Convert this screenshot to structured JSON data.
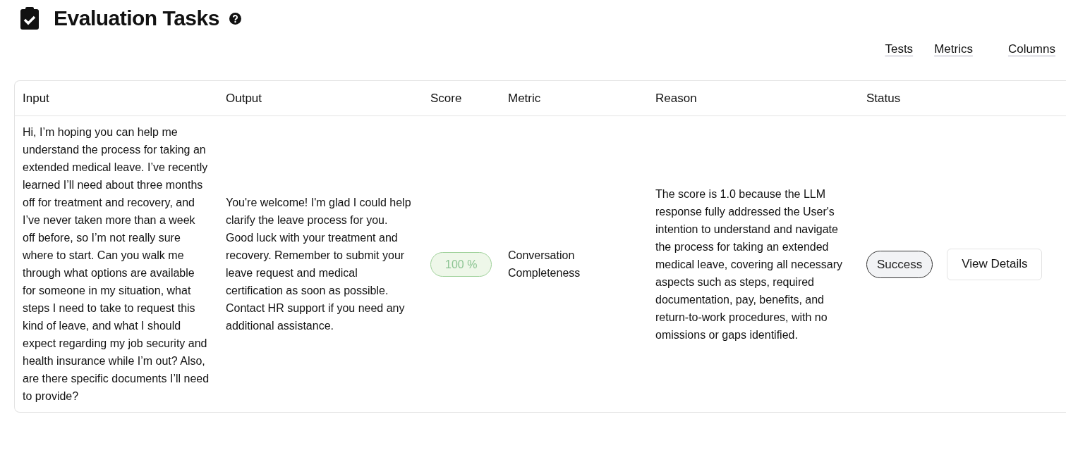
{
  "header": {
    "title": "Evaluation Tasks"
  },
  "toolbar_links": [
    "Tests",
    "Metrics",
    "Columns"
  ],
  "table": {
    "columns": [
      "Input",
      "Output",
      "Score",
      "Metric",
      "Reason",
      "Status"
    ],
    "rows": [
      {
        "input": "Hi, I’m hoping you can help me understand the process for taking an extended medical leave. I’ve recently learned I’ll need about three months off for treatment and recovery, and I’ve never taken more than a week off before, so I’m not really sure where to start. Can you walk me through what options are available for someone in my situation, what steps I need to take to request this kind of leave, and what I should expect regarding my job security and health insurance while I’m out? Also, are there specific documents I’ll need to provide?",
        "output": "You're welcome! I'm glad I could help clarify the leave process for you. Good luck with your treatment and recovery. Remember to submit your leave request and medical certification as soon as possible. Contact HR support if you need any additional assistance.",
        "score": {
          "label": "100 %",
          "kind": "pass"
        },
        "metric": "Conversation Completeness",
        "reason": "The score is 1.0 because the LLM response fully addressed the User's intention to understand and navigate the process for taking an extended medical leave, covering all necessary aspects such as steps, required documentation, pay, benefits, and return-to-work procedures, with no omissions or gaps identified.",
        "status": {
          "label": "Success",
          "kind": "success"
        },
        "action": "View Details"
      }
    ]
  }
}
